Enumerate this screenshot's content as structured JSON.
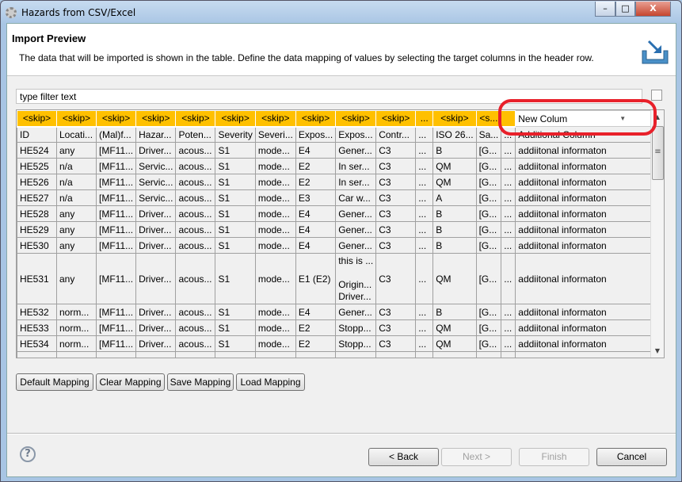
{
  "window": {
    "title": "Hazards from CSV/Excel",
    "minimize": "–",
    "maximize": "□",
    "close": "X"
  },
  "banner": {
    "title": "Import Preview",
    "description": "The data that will be imported is shown in the table. Define the data mapping of values by selecting the target columns in the header row."
  },
  "filter": {
    "placeholder": "type filter text"
  },
  "table": {
    "mapping": [
      "<skip>",
      "<skip>",
      "<skip>",
      "<skip>",
      "<skip>",
      "<skip>",
      "<skip>",
      "<skip>",
      "<skip>",
      "<skip>",
      "...",
      "<skip>",
      "<s...",
      ""
    ],
    "mapping_dropdown": "New Colum",
    "headers": [
      "ID",
      "Locati...",
      "(Mal)f...",
      "Hazar...",
      "Poten...",
      "Severity",
      "Severi...",
      "Expos...",
      "Expos...",
      "Contr...",
      "...",
      "ISO 26...",
      "Sa...",
      "...",
      "Additional Column"
    ],
    "rows": [
      [
        "HE524",
        "any",
        "[MF11...",
        "Driver...",
        "acous...",
        "S1",
        "mode...",
        "E4",
        "Gener...",
        "C3",
        "...",
        "B",
        "[G...",
        "...",
        "addiitonal informaton"
      ],
      [
        "HE525",
        "n/a",
        "[MF11...",
        "Servic...",
        "acous...",
        "S1",
        "mode...",
        "E2",
        "In ser...",
        "C3",
        "...",
        "QM",
        "[G...",
        "...",
        "addiitonal informaton"
      ],
      [
        "HE526",
        "n/a",
        "[MF11...",
        "Servic...",
        "acous...",
        "S1",
        "mode...",
        "E2",
        "In ser...",
        "C3",
        "...",
        "QM",
        "[G...",
        "...",
        "addiitonal informaton"
      ],
      [
        "HE527",
        "n/a",
        "[MF11...",
        "Servic...",
        "acous...",
        "S1",
        "mode...",
        "E3",
        "Car w...",
        "C3",
        "...",
        "A",
        "[G...",
        "...",
        "addiitonal informaton"
      ],
      [
        "HE528",
        "any",
        "[MF11...",
        "Driver...",
        "acous...",
        "S1",
        "mode...",
        "E4",
        "Gener...",
        "C3",
        "...",
        "B",
        "[G...",
        "...",
        "addiitonal informaton"
      ],
      [
        "HE529",
        "any",
        "[MF11...",
        "Driver...",
        "acous...",
        "S1",
        "mode...",
        "E4",
        "Gener...",
        "C3",
        "...",
        "B",
        "[G...",
        "...",
        "addiitonal informaton"
      ],
      [
        "HE530",
        "any",
        "[MF11...",
        "Driver...",
        "acous...",
        "S1",
        "mode...",
        "E4",
        "Gener...",
        "C3",
        "...",
        "B",
        "[G...",
        "...",
        "addiitonal informaton"
      ],
      [
        "HE531",
        "any",
        "[MF11...",
        "Driver...",
        "acous...",
        "S1",
        "mode...",
        "E1 (E2)",
        "this is ...\n\nOrigin...\nDriver...",
        "C3",
        "...",
        "QM",
        "[G...",
        "...",
        "addiitonal informaton"
      ],
      [
        "HE532",
        "norm...",
        "[MF11...",
        "Driver...",
        "acous...",
        "S1",
        "mode...",
        "E4",
        "Gener...",
        "C3",
        "...",
        "B",
        "[G...",
        "...",
        "addiitonal informaton"
      ],
      [
        "HE533",
        "norm...",
        "[MF11...",
        "Driver...",
        "acous...",
        "S1",
        "mode...",
        "E2",
        "Stopp...",
        "C3",
        "...",
        "QM",
        "[G...",
        "...",
        "addiitonal informaton"
      ],
      [
        "HE534",
        "norm...",
        "[MF11...",
        "Driver...",
        "acous...",
        "S1",
        "mode...",
        "E2",
        "Stopp...",
        "C3",
        "...",
        "QM",
        "[G...",
        "...",
        "addiitonal informaton"
      ]
    ]
  },
  "mapping_buttons": [
    "Default Mapping",
    "Clear Mapping",
    "Save Mapping",
    "Load Mapping"
  ],
  "nav": {
    "help": "?",
    "back": "< Back",
    "next": "Next >",
    "finish": "Finish",
    "cancel": "Cancel"
  },
  "colors": {
    "mapping_cell": "#ffc000",
    "highlight": "#e8202a"
  }
}
